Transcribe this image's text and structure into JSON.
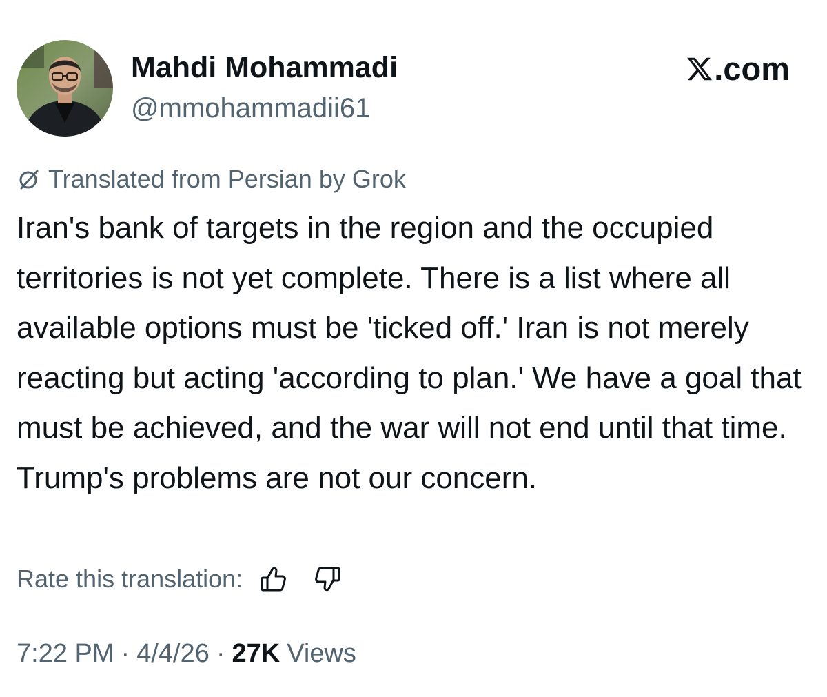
{
  "author": {
    "display_name": "Mahdi Mohammadi",
    "handle": "@mmohammadii61"
  },
  "brand": {
    "text": ".com",
    "icon": "x-logo-icon"
  },
  "translation": {
    "label": "Translated from Persian by Grok",
    "icon": "grok-icon",
    "rate_label": "Rate this translation:",
    "thumbs_up_icon": "thumbs-up-icon",
    "thumbs_down_icon": "thumbs-down-icon"
  },
  "tweet": {
    "text": "Iran's bank of targets in the region and the occupied territories is not yet complete. There is a list where all available options must be 'ticked off.' Iran is not merely reacting but acting 'according to plan.' We have a goal that must be achieved, and the war will not end until that time. Trump's problems are not our concern."
  },
  "meta": {
    "time": "7:22 PM",
    "separator": "·",
    "date": "4/4/26",
    "views_count": "27K",
    "views_label": "Views"
  },
  "colors": {
    "text_primary": "#0f1419",
    "text_secondary": "#536471",
    "background": "#ffffff"
  }
}
